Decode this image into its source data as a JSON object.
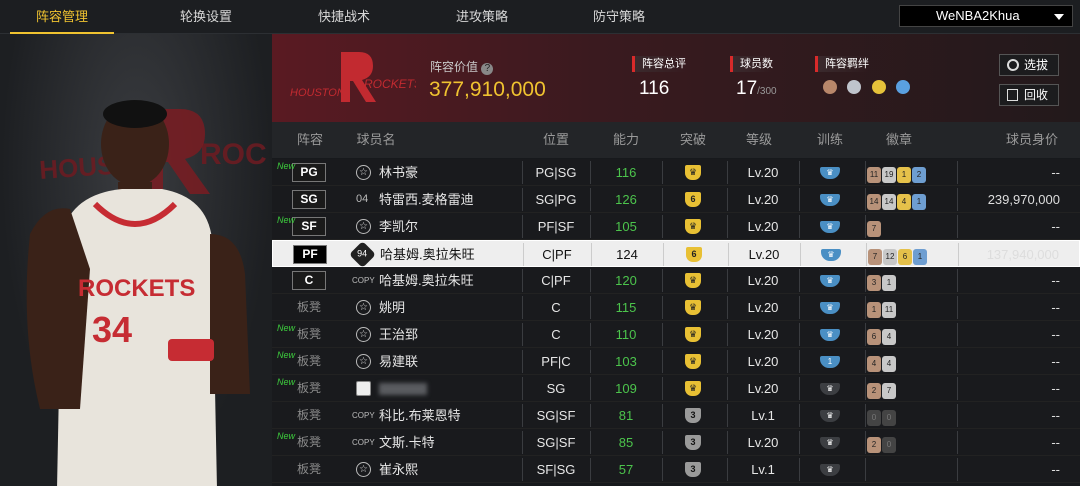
{
  "nav": {
    "tabs": [
      "阵容管理",
      "轮换设置",
      "快捷战术",
      "进攻策略",
      "防守策略"
    ],
    "active_tab": "阵容管理",
    "user": "WeNBA2Khua"
  },
  "team": {
    "name": "ROCKETS",
    "city": "HOUSTON",
    "jersey_number": "34",
    "value_label": "阵容价值",
    "value": "377,910,000",
    "overall_label": "阵容总评",
    "overall": "116",
    "count_label": "球员数",
    "count": "17",
    "count_max": "/300",
    "chem_label": "阵容羁绊",
    "select_button": "选拔",
    "recycle_button": "回收"
  },
  "table": {
    "headers": [
      "阵容",
      "球员名",
      "位置",
      "能力",
      "突破",
      "等级",
      "训练",
      "徽章",
      "球员身价"
    ],
    "rows": [
      {
        "slot": "PG",
        "new": "New",
        "icon": "star",
        "name": "林书豪",
        "pos": "PG|SG",
        "ability": "116",
        "break": "",
        "break_style": "gold",
        "level": "Lv.20",
        "train": "",
        "train_dim": false,
        "badges": [
          [
            "b-bronze",
            "11"
          ],
          [
            "b-silver",
            "19"
          ],
          [
            "b-gold",
            "1"
          ],
          [
            "b-blue",
            "2"
          ]
        ],
        "value": "--"
      },
      {
        "slot": "SG",
        "new": "",
        "icon": "num",
        "num": "04",
        "name": "特雷西.麦格雷迪",
        "pos": "SG|PG",
        "ability": "126",
        "break": "6",
        "break_style": "gold",
        "level": "Lv.20",
        "train": "",
        "train_dim": false,
        "badges": [
          [
            "b-bronze",
            "14"
          ],
          [
            "b-silver",
            "14"
          ],
          [
            "b-gold",
            "4"
          ],
          [
            "b-blue",
            "1"
          ]
        ],
        "value": "239,970,000"
      },
      {
        "slot": "SF",
        "new": "New",
        "icon": "star",
        "name": "李凯尔",
        "pos": "PF|SF",
        "ability": "105",
        "break": "",
        "break_style": "gold",
        "level": "Lv.20",
        "train": "",
        "train_dim": false,
        "badges": [
          [
            "b-bronze",
            "7"
          ]
        ],
        "value": "--"
      },
      {
        "slot": "PF",
        "new": "",
        "icon": "num",
        "num": "94",
        "name": "哈基姆.奥拉朱旺",
        "pos": "C|PF",
        "ability": "124",
        "break": "6",
        "break_style": "gold",
        "level": "Lv.20",
        "train": "",
        "train_dim": false,
        "badges": [
          [
            "b-bronze",
            "7"
          ],
          [
            "b-silver",
            "12"
          ],
          [
            "b-gold",
            "6"
          ],
          [
            "b-blue",
            "1"
          ]
        ],
        "value": "137,940,000",
        "selected": true
      },
      {
        "slot": "C",
        "new": "",
        "icon": "copy",
        "name": "哈基姆.奥拉朱旺",
        "pos": "C|PF",
        "ability": "120",
        "break": "",
        "break_style": "gold",
        "level": "Lv.20",
        "train": "",
        "train_dim": false,
        "badges": [
          [
            "b-bronze",
            "3"
          ],
          [
            "b-silver",
            "1"
          ]
        ],
        "value": "--"
      },
      {
        "slot": "板凳",
        "new": "",
        "icon": "star",
        "name": "姚明",
        "pos": "C",
        "ability": "115",
        "break": "",
        "break_style": "gold",
        "level": "Lv.20",
        "train": "",
        "train_dim": false,
        "badges": [
          [
            "b-bronze",
            "1"
          ],
          [
            "b-silver",
            "11"
          ]
        ],
        "value": "--"
      },
      {
        "slot": "板凳",
        "new": "New",
        "icon": "star",
        "name": "王治郅",
        "pos": "C",
        "ability": "110",
        "break": "",
        "break_style": "gold",
        "level": "Lv.20",
        "train": "",
        "train_dim": false,
        "badges": [
          [
            "b-bronze",
            "6"
          ],
          [
            "b-silver",
            "4"
          ]
        ],
        "value": "--"
      },
      {
        "slot": "板凳",
        "new": "New",
        "icon": "star",
        "name": "易建联",
        "pos": "PF|C",
        "ability": "103",
        "break": "",
        "break_style": "gold",
        "level": "Lv.20",
        "train": "1",
        "train_dim": false,
        "badges": [
          [
            "b-bronze",
            "4"
          ],
          [
            "b-silver",
            "4"
          ]
        ],
        "value": "--"
      },
      {
        "slot": "板凳",
        "new": "New",
        "icon": "avatar",
        "name": "",
        "pos": "SG",
        "ability": "109",
        "break": "",
        "break_style": "gold",
        "level": "Lv.20",
        "train": "",
        "train_dim": true,
        "badges": [
          [
            "b-bronze",
            "2"
          ],
          [
            "b-silver",
            "7"
          ]
        ],
        "value": "--"
      },
      {
        "slot": "板凳",
        "new": "",
        "icon": "copy",
        "name": "科比.布莱恩特",
        "pos": "SG|SF",
        "ability": "81",
        "break": "3",
        "break_style": "gray",
        "level": "Lv.1",
        "train": "",
        "train_dim": true,
        "badges": [
          [
            "b-dim",
            "0"
          ],
          [
            "b-dim",
            "0"
          ]
        ],
        "value": "--"
      },
      {
        "slot": "板凳",
        "new": "New",
        "icon": "copy",
        "name": "文斯.卡特",
        "pos": "SG|SF",
        "ability": "85",
        "break": "3",
        "break_style": "gray",
        "level": "Lv.20",
        "train": "",
        "train_dim": true,
        "badges": [
          [
            "b-bronze",
            "2"
          ],
          [
            "b-dim",
            "0"
          ]
        ],
        "value": "--"
      },
      {
        "slot": "板凳",
        "new": "",
        "icon": "star",
        "name": "崔永熙",
        "pos": "SF|SG",
        "ability": "57",
        "break": "3",
        "break_style": "gray",
        "level": "Lv.1",
        "train": "",
        "train_dim": true,
        "badges": [],
        "value": "--"
      }
    ]
  }
}
